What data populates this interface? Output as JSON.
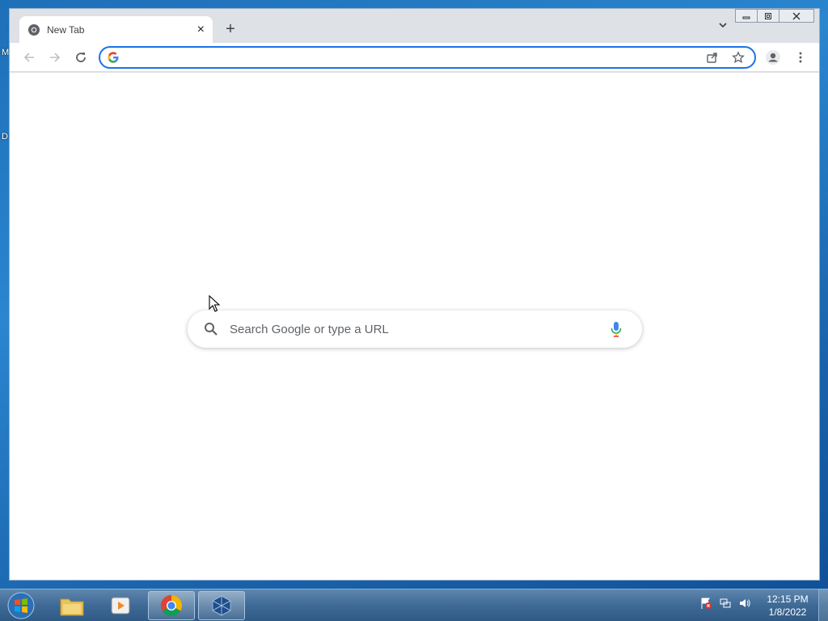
{
  "desktop": {
    "label_1": "M",
    "label_2": "D"
  },
  "browser": {
    "tab": {
      "title": "New Tab",
      "close_label": "×"
    },
    "new_tab_label": "+",
    "omnibox": {
      "value": "",
      "placeholder": ""
    },
    "search_box": {
      "placeholder": "Search Google or type a URL"
    }
  },
  "taskbar": {
    "clock_time": "12:15 PM",
    "clock_date": "1/8/2022"
  },
  "colors": {
    "accent": "#1a73e8",
    "google_blue": "#4285f4",
    "google_red": "#ea4335",
    "google_yellow": "#fbbc05",
    "google_green": "#34a853"
  }
}
